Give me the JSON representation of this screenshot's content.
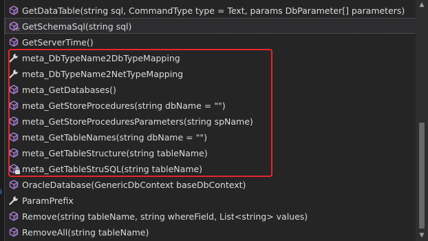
{
  "items": [
    {
      "label": "GetDataTable(string sql, CommandType type = Text, params DbParameter[] parameters)",
      "icon": "method-icon"
    },
    {
      "label": "GetSchemaSql(string sql)",
      "icon": "method-icon",
      "badge": "star"
    },
    {
      "label": "GetServerTime()",
      "icon": "method-icon"
    },
    {
      "label": "meta_DbTypeName2DbTypeMapping",
      "icon": "wrench-icon"
    },
    {
      "label": "meta_DbTypeName2NetTypeMapping",
      "icon": "wrench-icon"
    },
    {
      "label": "meta_GetDatabases()",
      "icon": "method-icon"
    },
    {
      "label": "meta_GetStoreProcedures(string dbName = \"\")",
      "icon": "method-icon"
    },
    {
      "label": "meta_GetStoreProceduresParameters(string spName)",
      "icon": "method-icon"
    },
    {
      "label": "meta_GetTableNames(string dbName = \"\")",
      "icon": "method-icon"
    },
    {
      "label": "meta_GetTableStructure(string tableName)",
      "icon": "method-icon"
    },
    {
      "label": "meta_GetTableStruSQL(string tableName)",
      "icon": "method-icon",
      "badge": "lock"
    },
    {
      "label": "OracleDatabase(GenericDbContext baseDbContext)",
      "icon": "method-icon"
    },
    {
      "label": "ParamPrefix",
      "icon": "wrench-icon"
    },
    {
      "label": "Remove(string tableName, string whereField, List<string> values)",
      "icon": "method-icon"
    },
    {
      "label": "RemoveAll(string tableName)",
      "icon": "method-icon"
    }
  ],
  "selected_index": 1,
  "highlight_color": "#e6262a",
  "method_icon_color": "#b180d7",
  "editor_margin_glyph": "i"
}
